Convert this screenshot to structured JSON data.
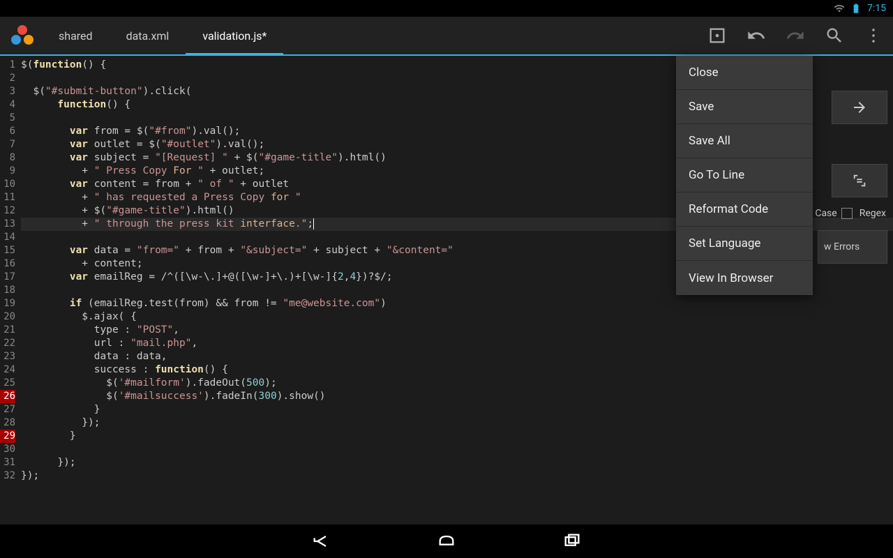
{
  "status": {
    "time": "7:15"
  },
  "tabs": {
    "t0": "shared",
    "t1": "data.xml",
    "t2": "validation.js*"
  },
  "toolbar": {},
  "menu": {
    "m0": "Close",
    "m1": "Save",
    "m2": "Save All",
    "m3": "Go To Line",
    "m4": "Reformat Code",
    "m5": "Set Language",
    "m6": "View In Browser"
  },
  "panel": {
    "case": "Case",
    "regex": "Regex",
    "errors": "w Errors"
  },
  "gutter": {
    "max": 32,
    "errors": [
      26,
      29
    ]
  },
  "code_lines": [
    {
      "n": 1,
      "seg": [
        [
          "p",
          "$("
        ],
        [
          "k",
          "function"
        ],
        [
          "p",
          "() {"
        ]
      ]
    },
    {
      "n": 2,
      "seg": []
    },
    {
      "n": 3,
      "seg": [
        [
          "p",
          "  $("
        ],
        [
          "s",
          "\"#submit-button\""
        ],
        [
          "p",
          ").click("
        ]
      ]
    },
    {
      "n": 4,
      "seg": [
        [
          "p",
          "      "
        ],
        [
          "k",
          "function"
        ],
        [
          "p",
          "() {"
        ]
      ]
    },
    {
      "n": 5,
      "seg": []
    },
    {
      "n": 6,
      "seg": [
        [
          "p",
          "        "
        ],
        [
          "k",
          "var"
        ],
        [
          "p",
          " from = $("
        ],
        [
          "s",
          "\"#from\""
        ],
        [
          "p",
          ").val();"
        ]
      ]
    },
    {
      "n": 7,
      "seg": [
        [
          "p",
          "        "
        ],
        [
          "k",
          "var"
        ],
        [
          "p",
          " outlet = $("
        ],
        [
          "s",
          "\"#outlet\""
        ],
        [
          "p",
          ").val();"
        ]
      ]
    },
    {
      "n": 8,
      "seg": [
        [
          "p",
          "        "
        ],
        [
          "k",
          "var"
        ],
        [
          "p",
          " subject = "
        ],
        [
          "s",
          "\"[Request] \""
        ],
        [
          "p",
          " + $("
        ],
        [
          "s",
          "\"#game-title\""
        ],
        [
          "p",
          ").html()"
        ]
      ]
    },
    {
      "n": 9,
      "seg": [
        [
          "p",
          "          + "
        ],
        [
          "s",
          "\" Press Copy "
        ],
        [
          "c",
          "For"
        ],
        [
          "s",
          " \""
        ],
        [
          "p",
          " + outlet;"
        ]
      ]
    },
    {
      "n": 10,
      "seg": [
        [
          "p",
          "        "
        ],
        [
          "k",
          "var"
        ],
        [
          "p",
          " content = from + "
        ],
        [
          "s",
          "\" of \""
        ],
        [
          "p",
          " + outlet"
        ]
      ]
    },
    {
      "n": 11,
      "seg": [
        [
          "p",
          "          + "
        ],
        [
          "s",
          "\" has requested a Press Copy "
        ],
        [
          "c",
          "for"
        ],
        [
          "s",
          " \""
        ]
      ]
    },
    {
      "n": 12,
      "seg": [
        [
          "p",
          "          + $("
        ],
        [
          "s",
          "\"#game-title\""
        ],
        [
          "p",
          ").html()"
        ]
      ]
    },
    {
      "n": 13,
      "hl": true,
      "seg": [
        [
          "p",
          "          + "
        ],
        [
          "s",
          "\" through the press kit "
        ],
        [
          "c",
          "interface"
        ],
        [
          "s",
          ".\""
        ],
        [
          "p",
          ";"
        ],
        [
          "cur",
          ""
        ]
      ]
    },
    {
      "n": 14,
      "seg": []
    },
    {
      "n": 15,
      "seg": [
        [
          "p",
          "        "
        ],
        [
          "k",
          "var"
        ],
        [
          "p",
          " data = "
        ],
        [
          "s",
          "\"from=\""
        ],
        [
          "p",
          " + from + "
        ],
        [
          "s",
          "\"&subject=\""
        ],
        [
          "p",
          " + subject + "
        ],
        [
          "s",
          "\"&content=\""
        ]
      ]
    },
    {
      "n": 16,
      "seg": [
        [
          "p",
          "          + content;"
        ]
      ]
    },
    {
      "n": 17,
      "seg": [
        [
          "p",
          "        "
        ],
        [
          "k",
          "var"
        ],
        [
          "p",
          " emailReg = /^([\\w-\\.]+@([\\w-]+\\.)+[\\w-]{"
        ],
        [
          "n",
          "2"
        ],
        [
          "p",
          ","
        ],
        [
          "n",
          "4"
        ],
        [
          "p",
          "})?$/;"
        ]
      ]
    },
    {
      "n": 18,
      "seg": []
    },
    {
      "n": 19,
      "seg": [
        [
          "p",
          "        "
        ],
        [
          "k",
          "if"
        ],
        [
          "p",
          " (emailReg.test(from) && from != "
        ],
        [
          "s",
          "\"me@website.com\""
        ],
        [
          "p",
          ")"
        ]
      ]
    },
    {
      "n": 20,
      "seg": [
        [
          "p",
          "          $.ajax( {"
        ]
      ]
    },
    {
      "n": 21,
      "seg": [
        [
          "p",
          "            type : "
        ],
        [
          "s",
          "\"POST\""
        ],
        [
          "p",
          ","
        ]
      ]
    },
    {
      "n": 22,
      "seg": [
        [
          "p",
          "            url : "
        ],
        [
          "s",
          "\"mail.php\""
        ],
        [
          "p",
          ","
        ]
      ]
    },
    {
      "n": 23,
      "seg": [
        [
          "p",
          "            data : data,"
        ]
      ]
    },
    {
      "n": 24,
      "seg": [
        [
          "p",
          "            success : "
        ],
        [
          "k",
          "function"
        ],
        [
          "p",
          "() {"
        ]
      ]
    },
    {
      "n": 25,
      "seg": [
        [
          "p",
          "              $("
        ],
        [
          "s",
          "'#mailform'"
        ],
        [
          "p",
          ").fadeOut("
        ],
        [
          "n",
          "500"
        ],
        [
          "p",
          ");"
        ]
      ]
    },
    {
      "n": 26,
      "seg": [
        [
          "p",
          "              $("
        ],
        [
          "s",
          "'#mailsuccess'"
        ],
        [
          "p",
          ").fadeIn("
        ],
        [
          "n",
          "300"
        ],
        [
          "p",
          ").show("
        ],
        [
          "c",
          ""
        ],
        [
          "p",
          ")"
        ]
      ]
    },
    {
      "n": 27,
      "seg": [
        [
          "p",
          "            }"
        ]
      ]
    },
    {
      "n": 28,
      "seg": [
        [
          "p",
          "          });"
        ]
      ]
    },
    {
      "n": 29,
      "seg": [
        [
          "p",
          "        }"
        ]
      ]
    },
    {
      "n": 30,
      "seg": []
    },
    {
      "n": 31,
      "seg": [
        [
          "p",
          "      });"
        ]
      ]
    },
    {
      "n": 32,
      "seg": [
        [
          "p",
          "});"
        ]
      ]
    }
  ]
}
